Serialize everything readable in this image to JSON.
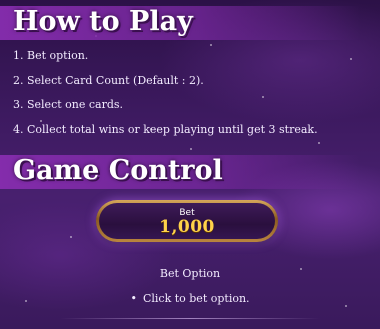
{
  "how_to_play": {
    "title": "How to Play",
    "steps": [
      "1. Bet option.",
      "2. Select Card Count (Default : 2).",
      "3. Select one cards.",
      "4. Collect total wins or keep playing until get 3 streak."
    ]
  },
  "game_control": {
    "title": "Game Control",
    "bet_button": {
      "label": "Bet",
      "value": "1,000"
    },
    "option_title": "Bet Option",
    "option_bullet_icon": "•",
    "option_bullet": "Click to bet option."
  },
  "colors": {
    "bet_value": "#ffd24a",
    "heading_band": "#872daf",
    "background": "#3d1a60"
  }
}
